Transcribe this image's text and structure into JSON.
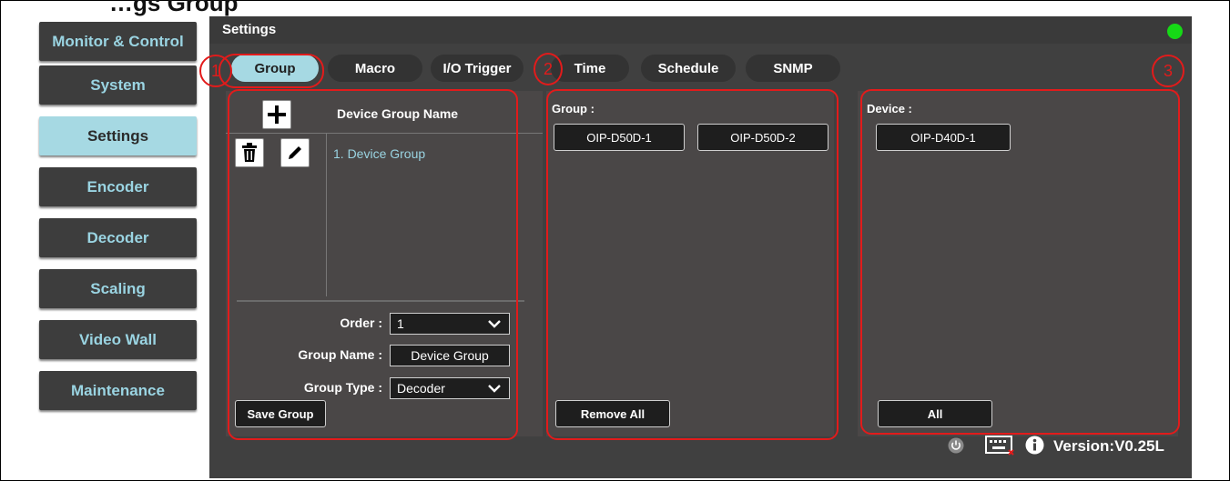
{
  "page_title": "…gs Group",
  "sidebar": {
    "items": [
      {
        "label": "Monitor & Control"
      },
      {
        "label": "System"
      },
      {
        "label": "Settings"
      },
      {
        "label": "Encoder"
      },
      {
        "label": "Decoder"
      },
      {
        "label": "Scaling"
      },
      {
        "label": "Video Wall"
      },
      {
        "label": "Maintenance"
      }
    ],
    "active": "Settings"
  },
  "main": {
    "title": "Settings",
    "status_color": "#16d916",
    "tabs": [
      {
        "label": "Group"
      },
      {
        "label": "Macro"
      },
      {
        "label": "I/O Trigger"
      },
      {
        "label": "Time"
      },
      {
        "label": "Schedule"
      },
      {
        "label": "SNMP"
      }
    ],
    "active_tab": "Group"
  },
  "callouts": [
    "1",
    "2",
    "3"
  ],
  "group_list": {
    "column_header": "Device Group Name",
    "items": [
      "1. Device Group"
    ]
  },
  "form": {
    "order_label": "Order :",
    "order_value": "1",
    "group_name_label": "Group Name :",
    "group_name_value": "Device Group",
    "group_type_label": "Group Type :",
    "group_type_value": "Decoder",
    "save_label": "Save Group"
  },
  "group_panel": {
    "label": "Group :",
    "devices": [
      "OIP-D50D-1",
      "OIP-D50D-2"
    ],
    "remove_all_label": "Remove All"
  },
  "device_panel": {
    "label": "Device :",
    "devices": [
      "OIP-D40D-1"
    ],
    "all_label": "All"
  },
  "footer": {
    "version": "Version:V0.25L"
  },
  "icons": [
    "plus-icon",
    "trash-icon",
    "pencil-icon",
    "chevron-down-icon",
    "power-icon",
    "keyboard-icon",
    "info-icon"
  ],
  "colors": {
    "accent": "#a6d9e3",
    "callout": "#e21b1b",
    "status": "#16d916"
  }
}
